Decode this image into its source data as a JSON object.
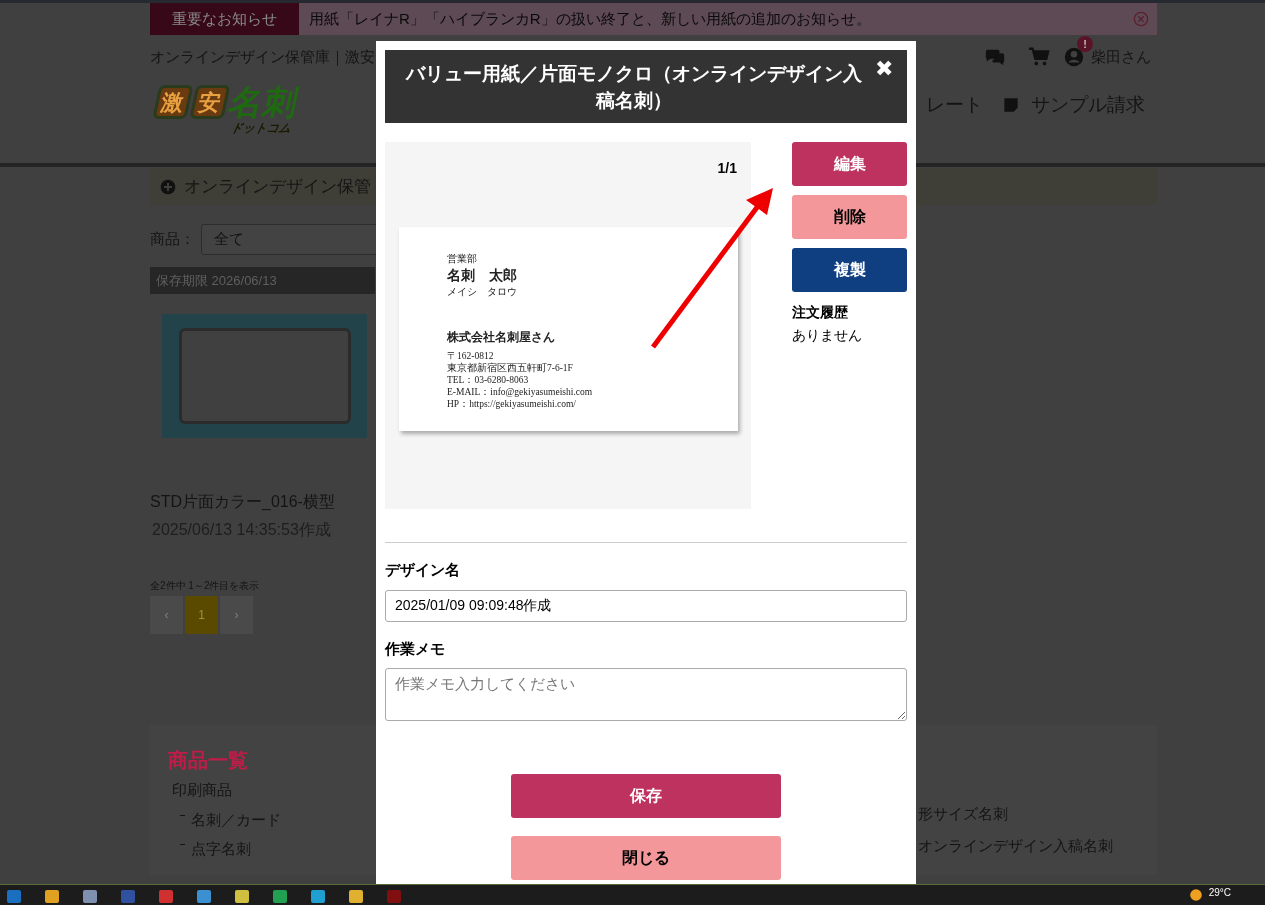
{
  "notice": {
    "label": "重要なお知らせ",
    "text": "用紙「レイナR」「ハイブランカR」の扱い終了と、新しい用紙の追加のお知らせ。"
  },
  "header": {
    "breadcrumb": "オンラインデザイン保管庫｜激安",
    "user": "柴田さん",
    "badge": "!",
    "logo": {
      "marks": [
        "激",
        "安"
      ],
      "word": "名刺",
      "sub": "ドットコム"
    },
    "nav": [
      "レート",
      "サンプル請求"
    ]
  },
  "section_bar": {
    "title": "オンラインデザイン保管"
  },
  "filter": {
    "label": "商品：",
    "value": "全て"
  },
  "design_card": {
    "expiry": "保存期限 2026/06/13",
    "name": "STD片面カラー_016-横型",
    "created": "2025/06/13 14:35:53作成"
  },
  "pagination": {
    "summary": "全2件中 1～2件目を表示",
    "pages": [
      {
        "label": "‹",
        "selected": false
      },
      {
        "label": "1",
        "selected": true
      },
      {
        "label": "›",
        "selected": false
      }
    ]
  },
  "footer": {
    "title": "商品一覧",
    "group": "印刷商品",
    "left_links": [
      "名刺／カード",
      "点字名刺"
    ],
    "right_links": [
      "形サイズ名刺",
      "オンラインデザイン入稿名刺"
    ]
  },
  "modal": {
    "title": "バリュー用紙／片面モノクロ（オンラインデザイン入稿名刺）",
    "close": "✖",
    "page_count": "1/1",
    "card": {
      "department": "営業部",
      "name": "名刺　太郎",
      "reading": "メイシ　タロウ",
      "company": "株式会社名刺屋さん",
      "lines": [
        "〒162-0812",
        "東京都新宿区西五軒町7-6-1F",
        "TEL：03-6280-8063",
        "E-MAIL：info@gekiyasumeishi.com",
        "HP：https://gekiyasumeishi.com/"
      ]
    },
    "actions": [
      {
        "label": "編集",
        "kind": "primary"
      },
      {
        "label": "削除",
        "kind": "danger"
      },
      {
        "label": "複製",
        "kind": "navy"
      }
    ],
    "history_label": "注文履歴",
    "history_value": "ありません",
    "design_name_label": "デザイン名",
    "design_name_value": "2025/01/09 09:09:48作成",
    "memo_label": "作業メモ",
    "memo_placeholder": "作業メモ入力してください",
    "buttons": [
      {
        "label": "保存",
        "kind": "primary"
      },
      {
        "label": "閉じる",
        "kind": "danger"
      }
    ]
  },
  "taskbar": {
    "temperature": "29°C"
  }
}
